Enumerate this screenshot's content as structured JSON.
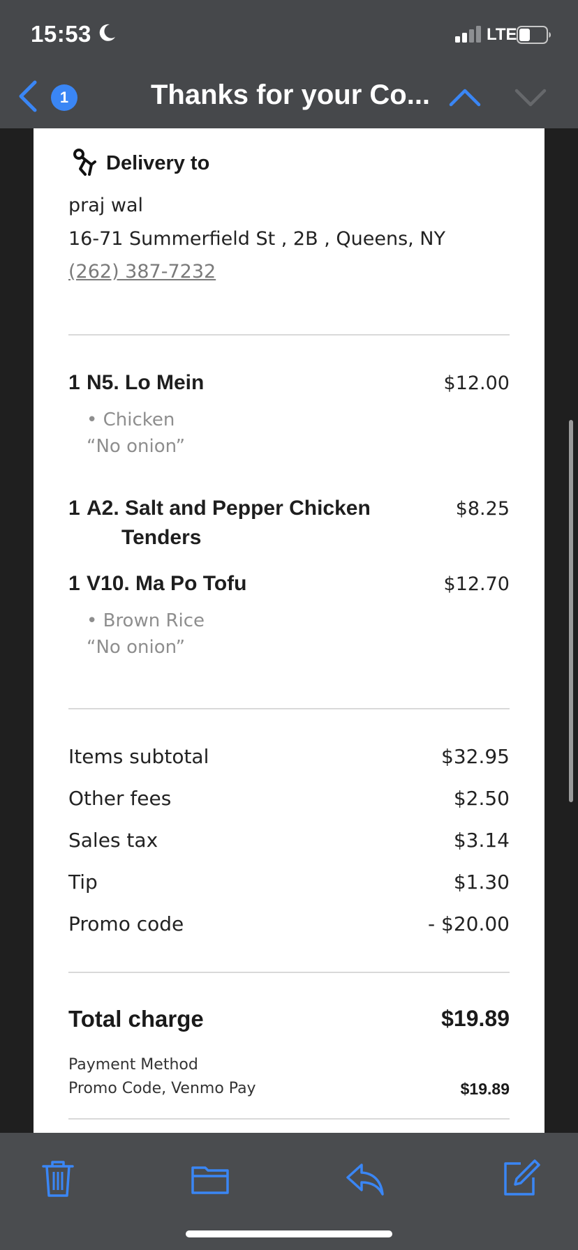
{
  "status_bar": {
    "time": "15:53",
    "network": "LTE"
  },
  "nav": {
    "badge_count": "1",
    "title": "Thanks for your Co..."
  },
  "delivery": {
    "heading": "Delivery to",
    "name": "praj wal",
    "address": "16-71 Summerfield St , 2B , Queens, NY",
    "phone": "(262) 387-7232"
  },
  "items": [
    {
      "qty": "1",
      "name_line1": "N5. Lo Mein",
      "name_line2": "",
      "price": "$12.00",
      "modifier": "• Chicken",
      "note": "“No onion”"
    },
    {
      "qty": "1",
      "name_line1": "A2. Salt and Pepper Chicken",
      "name_line2": "Tenders",
      "price": "$8.25",
      "modifier": "",
      "note": ""
    },
    {
      "qty": "1",
      "name_line1": "V10. Ma Po Tofu",
      "name_line2": "",
      "price": "$12.70",
      "modifier": "• Brown Rice",
      "note": "“No onion”"
    }
  ],
  "fees": [
    {
      "label": "Items subtotal",
      "value": "$32.95"
    },
    {
      "label": "Other fees",
      "value": "$2.50"
    },
    {
      "label": "Sales tax",
      "value": "$3.14"
    },
    {
      "label": "Tip",
      "value": "$1.30"
    },
    {
      "label": "Promo code",
      "value": "- $20.00"
    }
  ],
  "total": {
    "label": "Total charge",
    "value": "$19.89"
  },
  "payment": {
    "label": "Payment Method",
    "methods": "Promo Code, Venmo Pay",
    "value": "$19.89"
  },
  "colors": {
    "accent": "#3a86f5",
    "chrome": "#46484b",
    "toolbar": "#4a4c4f"
  },
  "toolbar_icons": [
    "trash-icon",
    "folder-icon",
    "reply-icon",
    "compose-icon"
  ]
}
